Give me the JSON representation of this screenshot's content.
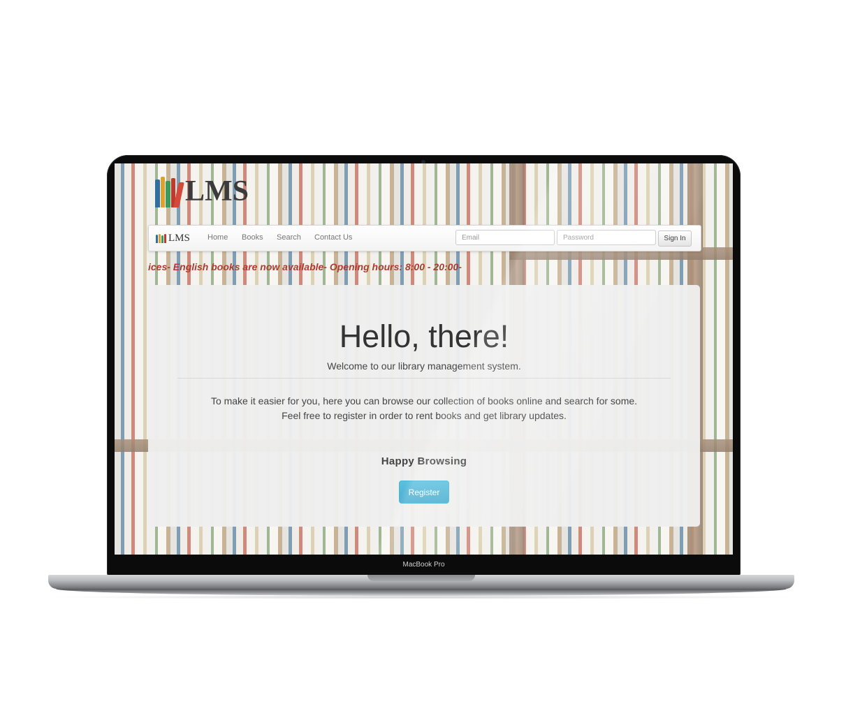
{
  "device": {
    "label": "MacBook Pro"
  },
  "site": {
    "brand": "LMS",
    "nav": {
      "brand": "LMS",
      "links": [
        "Home",
        "Books",
        "Search",
        "Contact Us"
      ],
      "email_placeholder": "Email",
      "password_placeholder": "Password",
      "signin_label": "Sign In"
    },
    "marquee": "ices- English books are now available- Opening hours: 8:00 - 20:00-",
    "hero": {
      "title": "Hello, there!",
      "welcome": "Welcome to our library management system.",
      "line1": "To make it easier for you, here you can browse our collection of books online and search for some.",
      "line2": "Feel free to register in order to rent books and get library updates.",
      "tagline": "Happy Browsing",
      "register_label": "Register"
    }
  },
  "colors": {
    "accent": "#5bc0de",
    "marquee_text": "#b03a2e",
    "jumbotron_bg": "#eeeeee",
    "navbar_bg": "#f7f7f7"
  },
  "icons": {
    "logo": "stacked-books-logo"
  }
}
